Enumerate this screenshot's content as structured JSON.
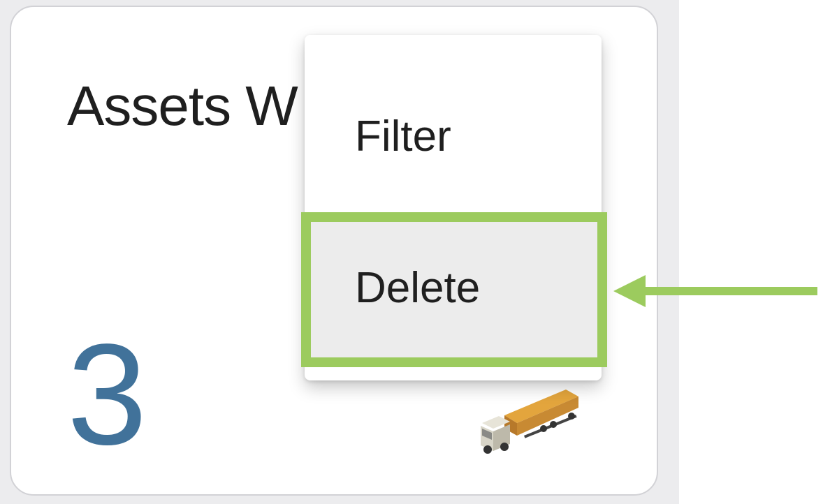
{
  "card": {
    "title": "Assets W",
    "count": "3",
    "image": "truck-icon"
  },
  "menu": {
    "items": [
      {
        "label": "Filter",
        "highlighted": false
      },
      {
        "label": "Delete",
        "highlighted": true
      }
    ]
  },
  "annotation": {
    "highlight_color": "#9ccb5e",
    "arrow_color": "#9ccb5e",
    "arrow_icon": "left-arrow-icon"
  },
  "colors": {
    "count": "#41729a",
    "text": "#1f1f1f",
    "hover_bg": "#ececec"
  }
}
